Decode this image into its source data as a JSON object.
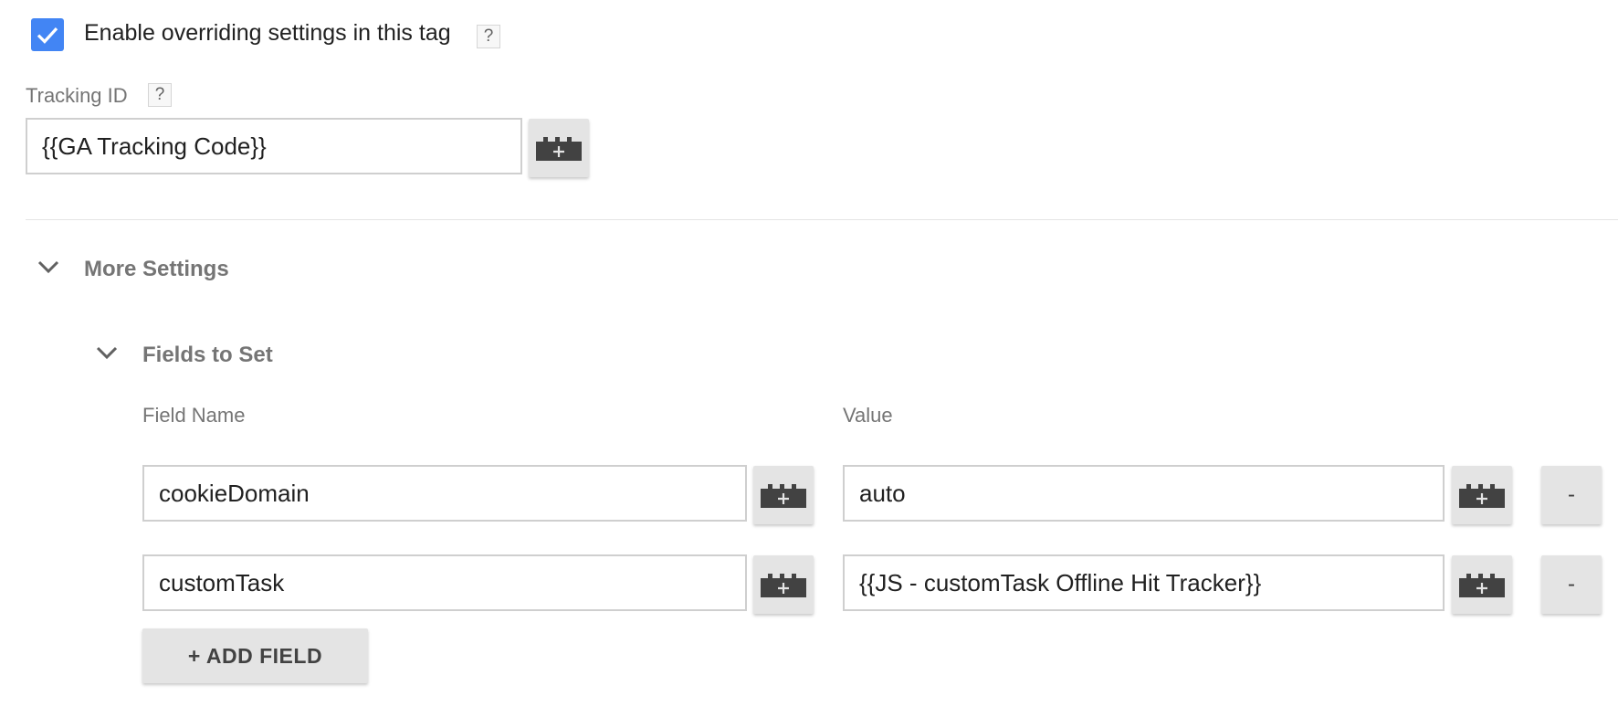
{
  "override": {
    "label": "Enable overriding settings in this tag",
    "checked": true,
    "help": "?"
  },
  "tracking": {
    "label": "Tracking ID",
    "help": "?",
    "value": "{{GA Tracking Code}}"
  },
  "more_settings": {
    "title": "More Settings"
  },
  "fields_to_set": {
    "title": "Fields to Set",
    "col_name": "Field Name",
    "col_value": "Value",
    "rows": [
      {
        "name": "cookieDomain",
        "value": "auto",
        "remove": "-"
      },
      {
        "name": "customTask",
        "value": "{{JS - customTask Offline Hit Tracker}}",
        "remove": "-"
      }
    ],
    "add_label": "+ ADD FIELD"
  },
  "colors": {
    "checkbox": "#4285f4",
    "button_bg": "#e4e4e4",
    "label_gray": "#757575"
  },
  "icons": {
    "checkbox": "checkmark-icon",
    "variable": "variable-brick-icon",
    "chevron": "chevron-down-icon"
  }
}
